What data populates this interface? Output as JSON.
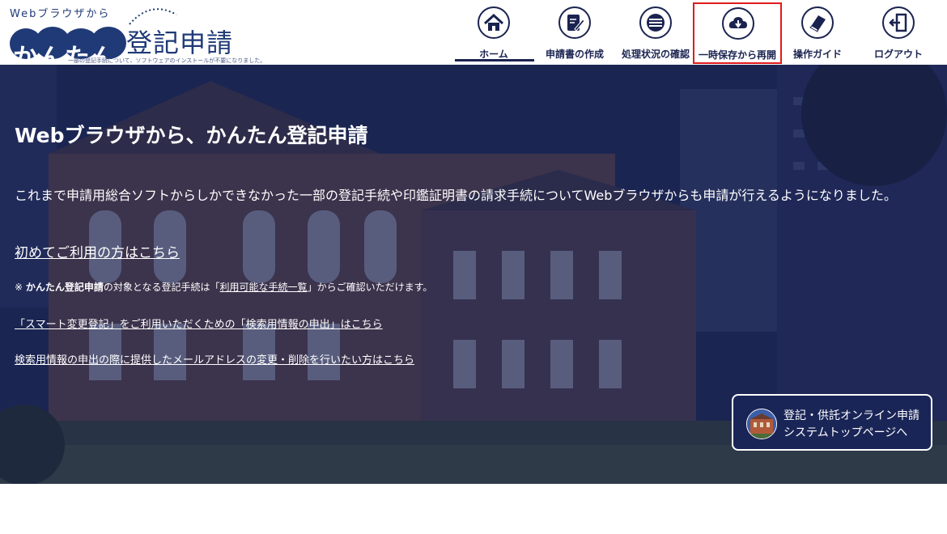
{
  "logo": {
    "top_text": "Webブラウザから",
    "kantan": "かんたん",
    "touki": "登記申請",
    "tagline": "一部の登記手続について、ソフトウェアのインストールが不要になりました。"
  },
  "nav": {
    "items": [
      {
        "label": "ホーム",
        "icon": "home-icon",
        "active": true
      },
      {
        "label": "申請書の作成",
        "icon": "edit-document-icon"
      },
      {
        "label": "処理状況の確認",
        "icon": "list-status-icon"
      },
      {
        "label": "一時保存から再開",
        "icon": "cloud-download-icon",
        "highlighted": true
      },
      {
        "label": "操作ガイド",
        "icon": "book-icon"
      },
      {
        "label": "ログアウト",
        "icon": "logout-icon"
      }
    ]
  },
  "hero": {
    "title": "Webブラウザから、かんたん登記申請",
    "description": "これまで申請用総合ソフトからしかできなかった一部の登記手続や印鑑証明書の請求手続についてWebブラウザからも申請が行えるようになりました。",
    "first_time_link": "初めてご利用の方はこちら",
    "note_prefix": "※ ",
    "note_bold": "かんたん登記申請",
    "note_middle": "の対象となる登記手続は「",
    "note_link": "利用可能な手続一覧",
    "note_suffix": "」からご確認いただけます。",
    "smart_link": "「スマート変更登記」をご利用いただくための「検索用情報の申出」はこちら",
    "mail_link": "検索用情報の申出の際に提供したメールアドレスの変更・削除を行いたい方はこちら"
  },
  "top_button": {
    "line1": "登記・供託オンライン申請",
    "line2": "システムトップページへ"
  },
  "colors": {
    "navy": "#1a2350",
    "highlight": "#e01b1b"
  }
}
